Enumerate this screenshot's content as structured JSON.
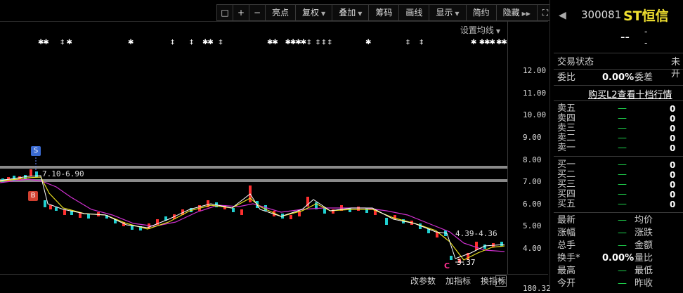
{
  "toolbar": {
    "items": [
      "亮点",
      "复权",
      "叠加",
      "筹码",
      "画线",
      "显示",
      "简约",
      "隐藏"
    ]
  },
  "chart": {
    "ma_setting": "设置均线",
    "price_axis": [
      "12.00",
      "11.00",
      "10.00",
      "9.00",
      "8.00",
      "7.00",
      "6.00",
      "5.00",
      "4.00"
    ],
    "marker_s": "S",
    "marker_b": "B",
    "marker_c": "C",
    "range_top": "7.10-6.90",
    "range_mid": "4.39-4.36",
    "low_label": "3.37",
    "bottom_axis_value": "180.32",
    "colors": {
      "ma_yellow": "#e8e020",
      "ma_magenta": "#d030d0",
      "ma_white": "#ffffff",
      "candle_up": "#ff3030",
      "candle_down": "#20d0d0"
    }
  },
  "bottom_bar": [
    "改参数",
    "加指标",
    "换指标"
  ],
  "panel": {
    "code": "300081",
    "name": "ST恒信",
    "price": "--",
    "change": "-",
    "change_pct": "-",
    "trade_status_label": "交易状态",
    "trade_status_value": "未开",
    "weibi_label": "委比",
    "weibi_value": "0.00%",
    "weicha_label": "委差",
    "l2_button": "购买L2查看十档行情",
    "sells": [
      {
        "label": "卖五",
        "price": "—",
        "vol": "0"
      },
      {
        "label": "卖四",
        "price": "—",
        "vol": "0"
      },
      {
        "label": "卖三",
        "price": "—",
        "vol": "0"
      },
      {
        "label": "卖二",
        "price": "—",
        "vol": "0"
      },
      {
        "label": "卖一",
        "price": "—",
        "vol": "0"
      }
    ],
    "buys": [
      {
        "label": "买一",
        "price": "—",
        "vol": "0"
      },
      {
        "label": "买二",
        "price": "—",
        "vol": "0"
      },
      {
        "label": "买三",
        "price": "—",
        "vol": "0"
      },
      {
        "label": "买四",
        "price": "—",
        "vol": "0"
      },
      {
        "label": "买五",
        "price": "—",
        "vol": "0"
      }
    ],
    "stats": [
      {
        "l1": "最新",
        "v1": "—",
        "l2": "均价",
        "v2": ""
      },
      {
        "l1": "涨幅",
        "v1": "—",
        "l2": "涨跌",
        "v2": ""
      },
      {
        "l1": "总手",
        "v1": "—",
        "l2": "金额",
        "v2": ""
      },
      {
        "l1": "换手*",
        "v1": "0.00%",
        "l2": "量比",
        "v2": ""
      },
      {
        "l1": "最高",
        "v1": "—",
        "l2": "最低",
        "v2": ""
      },
      {
        "l1": "今开",
        "v1": "—",
        "l2": "昨收",
        "v2": ""
      }
    ]
  }
}
